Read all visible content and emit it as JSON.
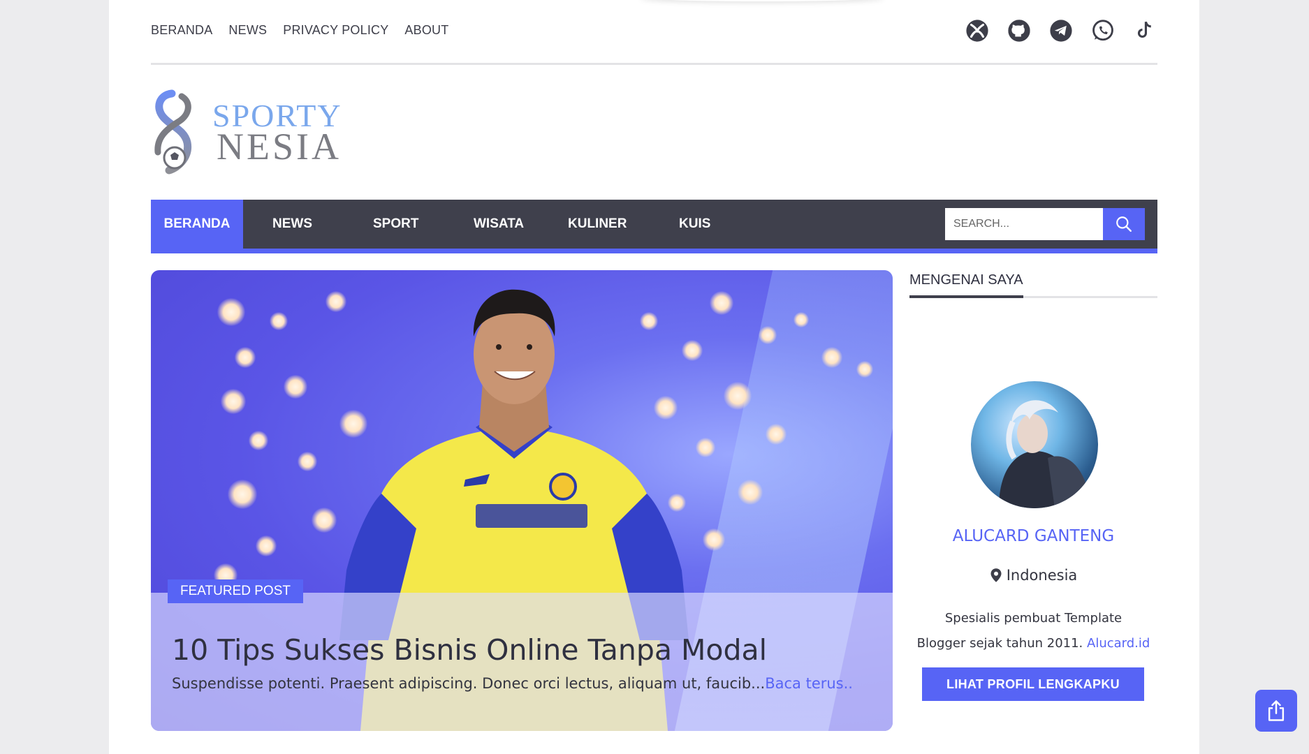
{
  "top_nav": {
    "items": [
      {
        "label": "BERANDA"
      },
      {
        "label": "NEWS"
      },
      {
        "label": "PRIVACY POLICY"
      },
      {
        "label": "ABOUT"
      }
    ]
  },
  "social_icons": [
    "xbox-icon",
    "github-icon",
    "telegram-icon",
    "whatsapp-icon",
    "tiktok-icon"
  ],
  "logo": {
    "line1": "SPORTY",
    "line2": "NESIA"
  },
  "main_nav": {
    "items": [
      {
        "label": "BERANDA",
        "active": true
      },
      {
        "label": "NEWS"
      },
      {
        "label": "SPORT"
      },
      {
        "label": "WISATA"
      },
      {
        "label": "KULINER"
      },
      {
        "label": "KUIS"
      }
    ],
    "search_placeholder": "SEARCH..."
  },
  "featured": {
    "tag": "FEATURED POST",
    "title": "10 Tips Sukses Bisnis Online Tanpa Modal",
    "excerpt": "Suspendisse potenti. Praesent adipiscing. Donec orci lectus, aliquam ut, faucib...",
    "read_more": "Baca terus.."
  },
  "sidebar": {
    "widget_title": "MENGENAI SAYA",
    "profile_name": "ALUCARD GANTENG",
    "location": "Indonesia",
    "bio_line1": "Spesialis pembuat Template",
    "bio_line2": "Blogger sejak tahun 2011.",
    "bio_link": "Alucard.id",
    "button_label": "LIHAT PROFIL LENGKAPKU"
  },
  "colors": {
    "accent": "#5764f5",
    "nav_dark": "#3f404c",
    "text": "#3d3e49",
    "page_bg": "#ececee"
  }
}
